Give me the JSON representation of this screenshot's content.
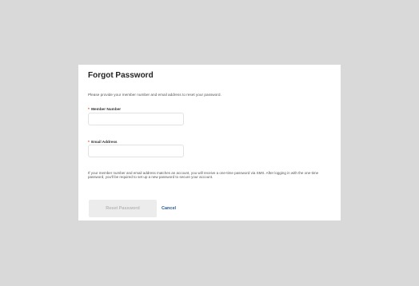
{
  "dialog": {
    "title": "Forgot Password",
    "instruction": "Please provide your member number and email address to reset your password.",
    "member_number": {
      "required_mark": "*",
      "label": "Member Number",
      "value": ""
    },
    "email_address": {
      "required_mark": "*",
      "label": "Email Address",
      "value": ""
    },
    "info_text": "If your member number and email address matches an account, you will receive a one-time password via SMS. After logging in with the one-time password, you'll be required to set up a new password to secure your account.",
    "reset_button_label": "Reset Password",
    "cancel_button_label": "Cancel"
  }
}
